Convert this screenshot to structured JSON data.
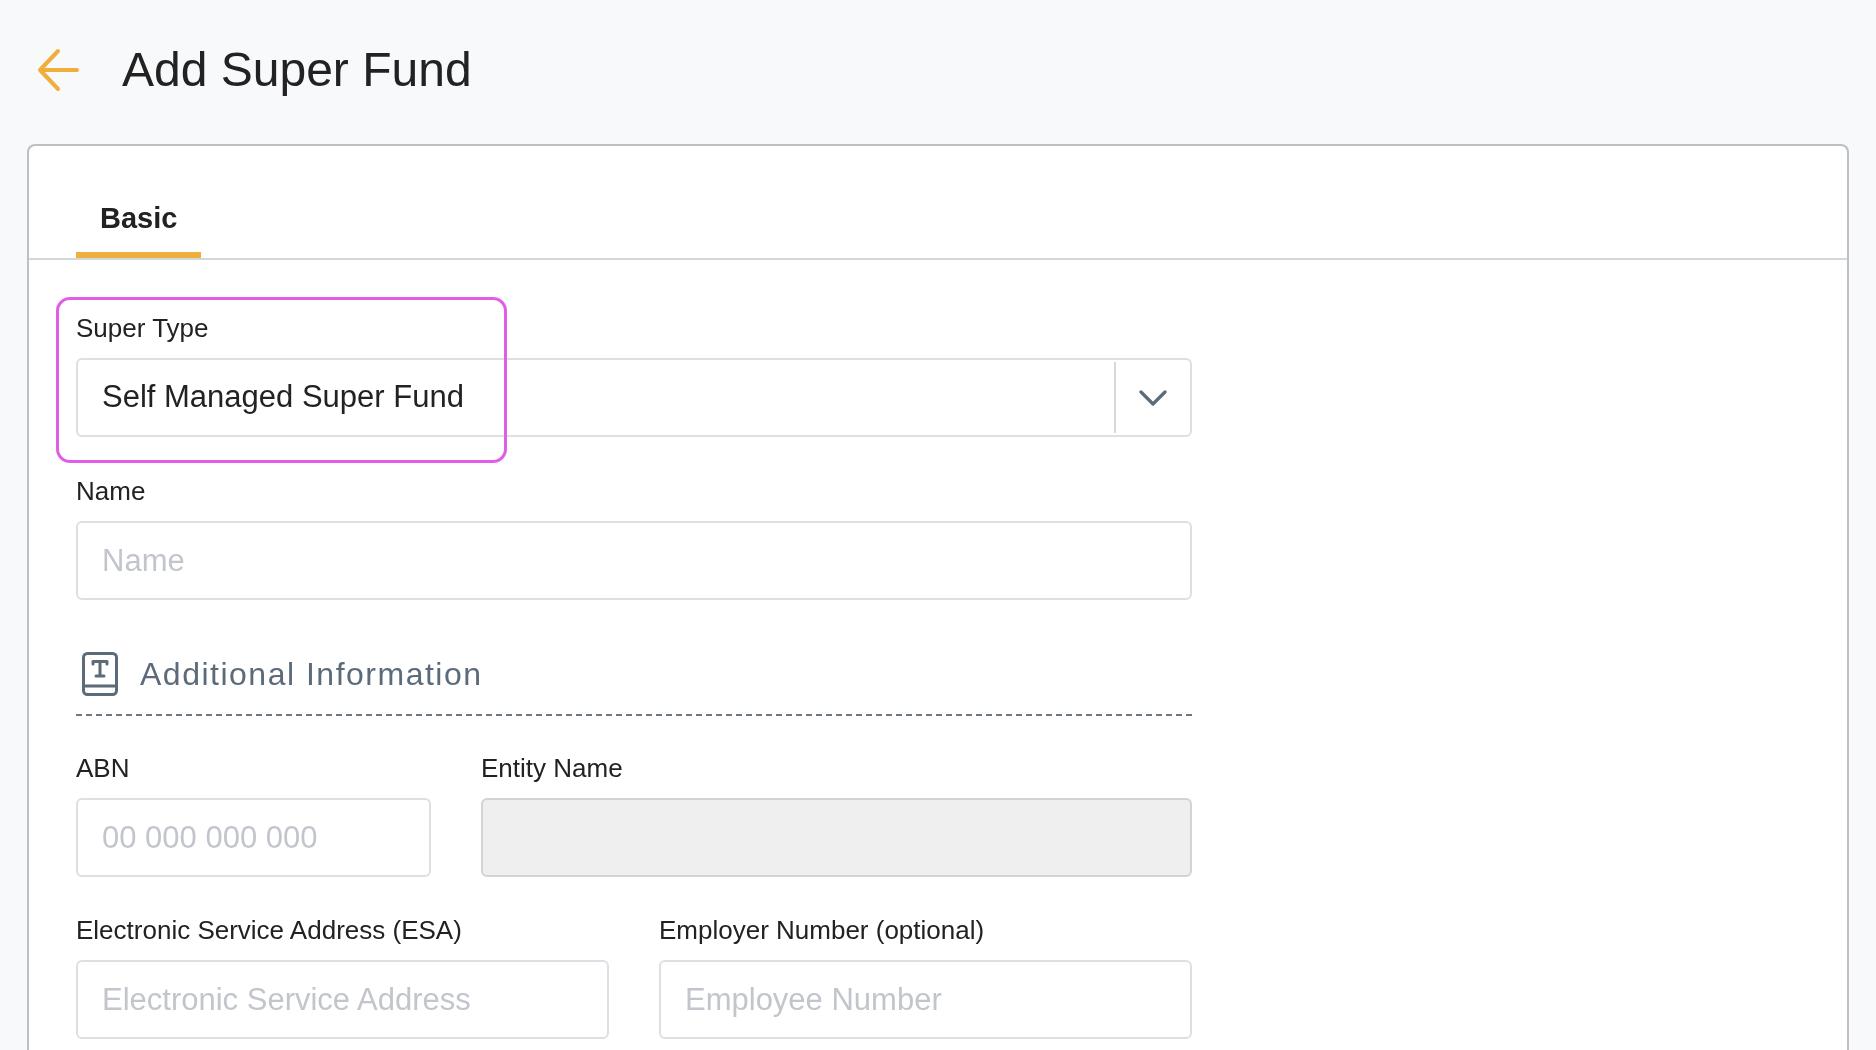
{
  "header": {
    "title": "Add Super Fund"
  },
  "tabs": [
    {
      "label": "Basic",
      "selected": true
    }
  ],
  "super_type": {
    "label": "Super Type",
    "value": "Self Managed Super Fund",
    "highlighted": true
  },
  "name_field": {
    "label": "Name",
    "placeholder": "Name"
  },
  "additional_information": {
    "title": "Additional Information",
    "rows": [
      {
        "fields": [
          {
            "label": "ABN",
            "placeholder": "00 000 000 000",
            "disabled": false
          },
          {
            "label": "Entity Name",
            "disabled": true
          }
        ]
      },
      {
        "fields": [
          {
            "label": "Electronic Service Address (ESA)",
            "placeholder": "Electronic Service Address",
            "disabled": false
          },
          {
            "label": "Employer Number (optional)",
            "placeholder": "Employee Number",
            "disabled": false
          }
        ]
      }
    ]
  }
}
